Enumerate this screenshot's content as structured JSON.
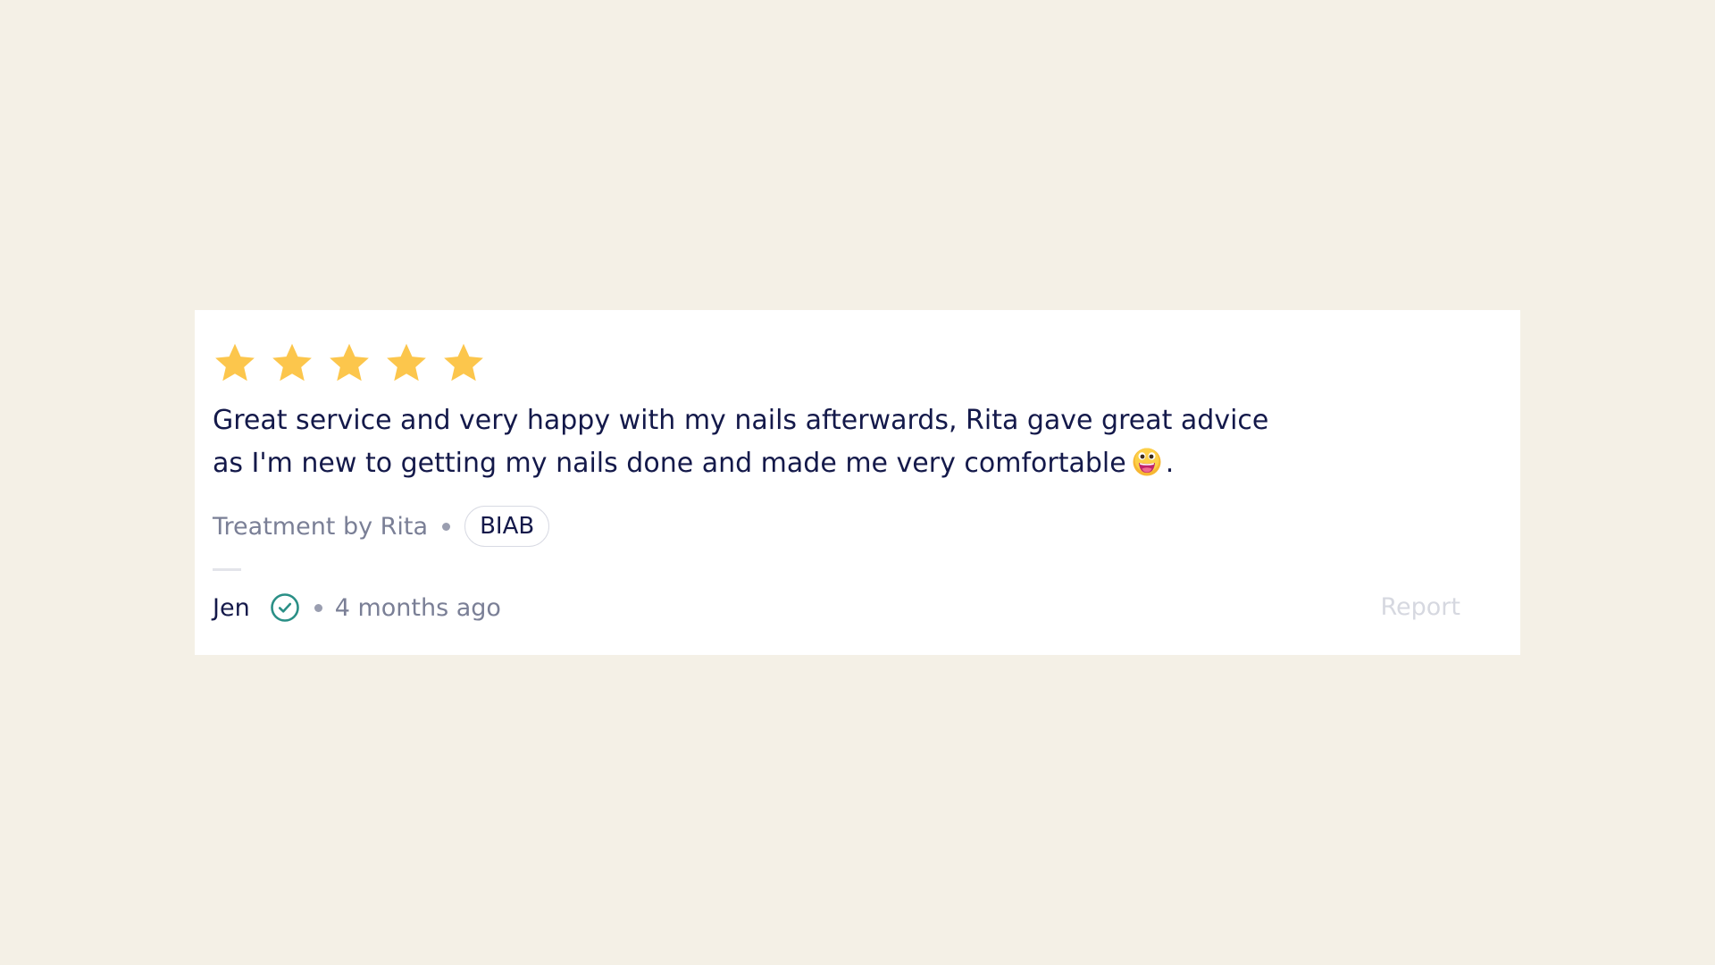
{
  "review": {
    "rating": 5,
    "rating_max": 5,
    "star_color": "#fcc64c",
    "text_part1": "Great service and very happy with my nails afterwards, Rita gave great advice as I'm new to getting my nails done and made me very comfortable",
    "emoji": "grinning-face-icon",
    "text_part2": ".",
    "treatment_by": "Treatment by Rita",
    "treatment_tag": "BIAB",
    "author": "Jen",
    "verified_icon": "verified-check-icon",
    "verified_color": "#2a8f86",
    "time_ago": "4 months ago",
    "report_label": "Report"
  }
}
